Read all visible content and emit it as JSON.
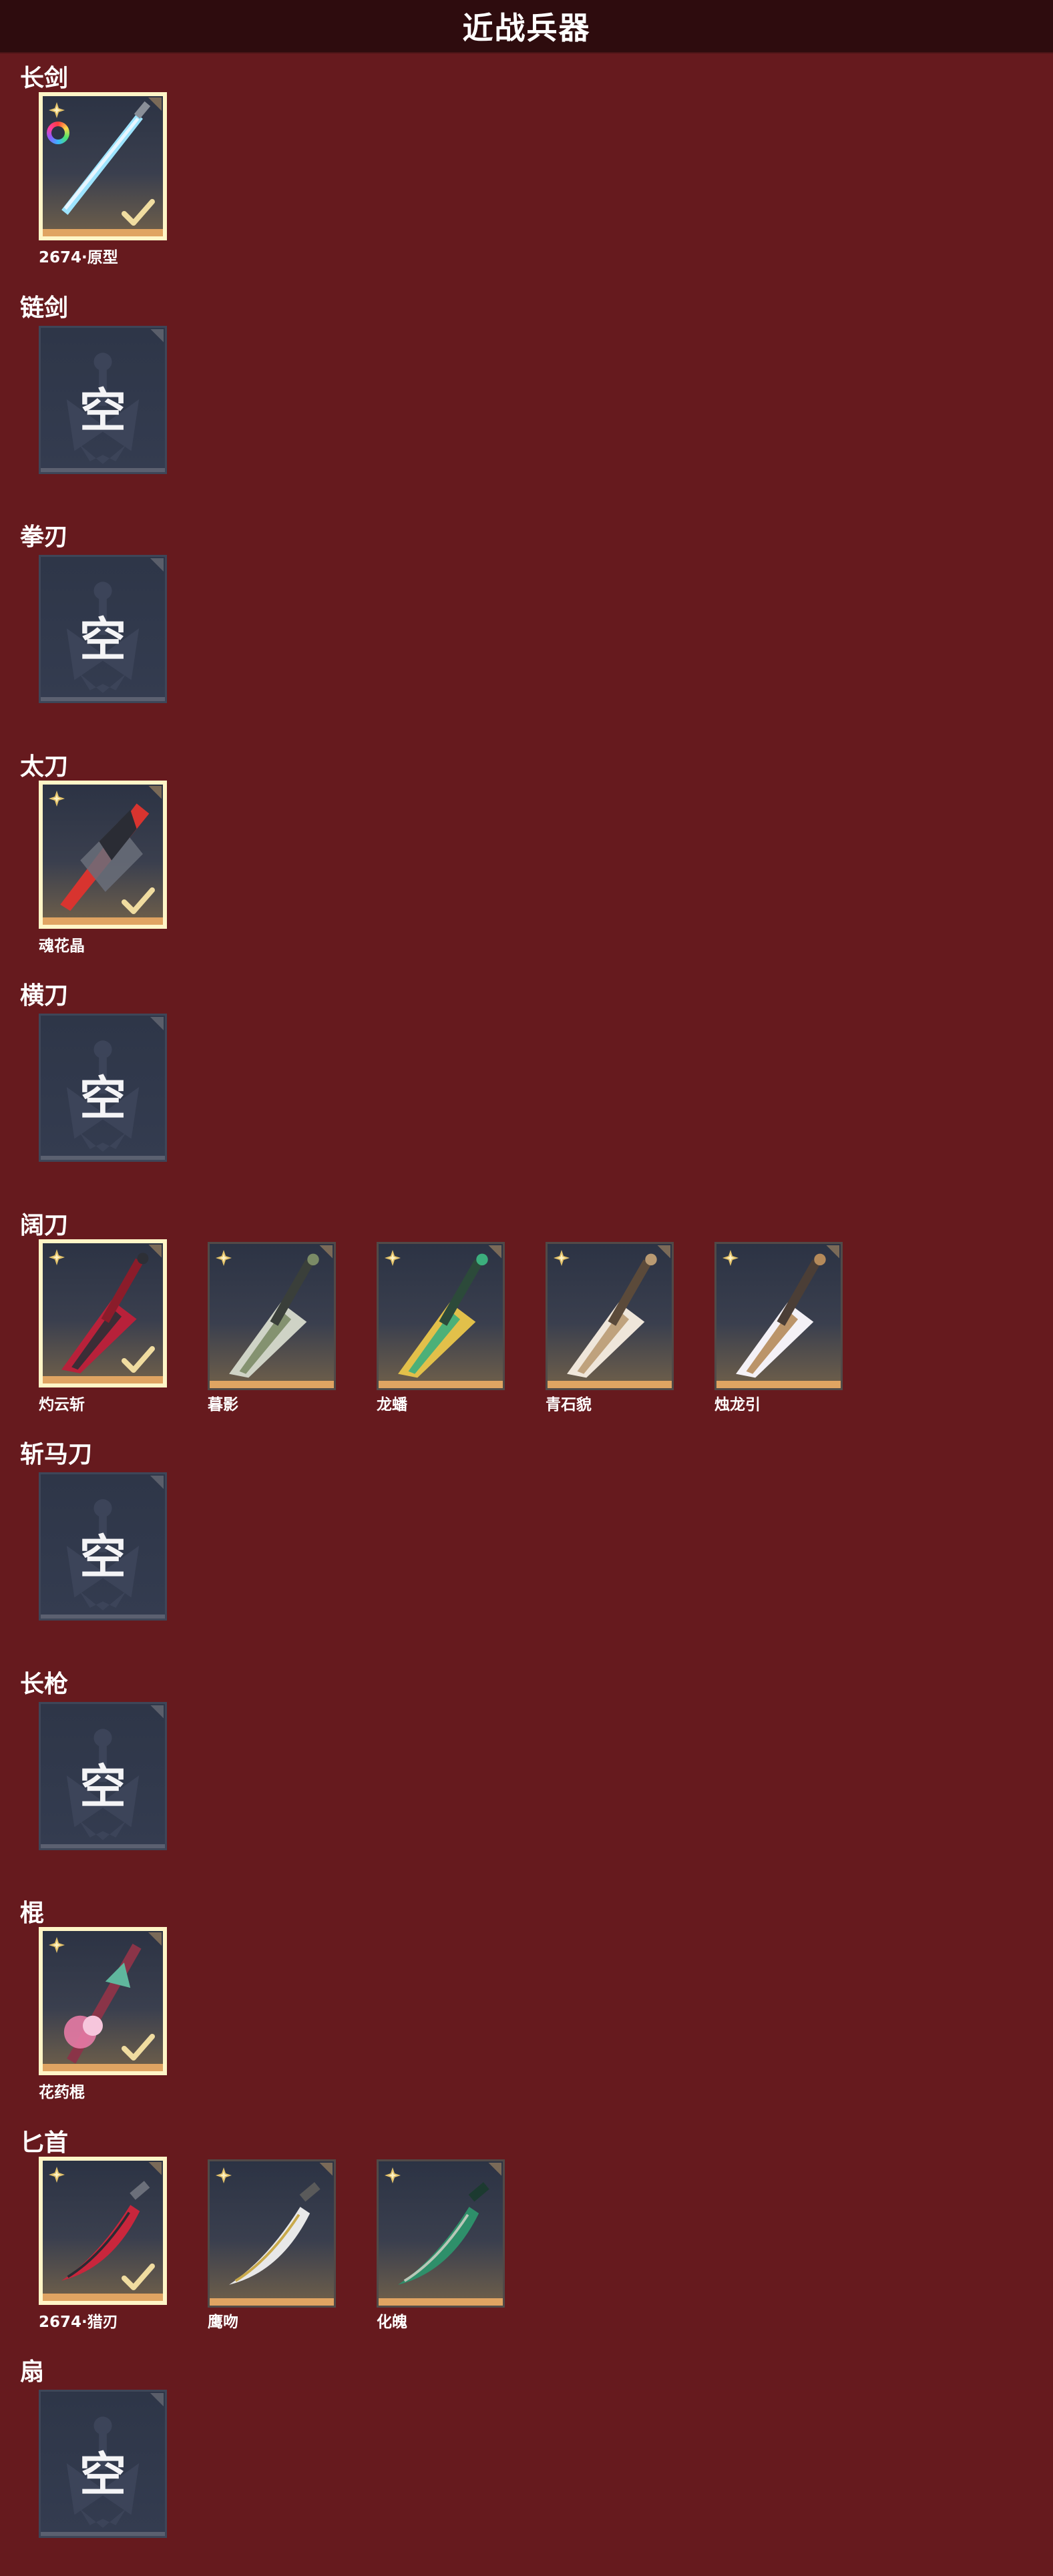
{
  "header": {
    "title": "近战兵器"
  },
  "empty_label": "空",
  "colors": {
    "background": "#661a1e",
    "header_bar": "#2e0c0e",
    "selected_border": "#fff5c7",
    "owned_bar": "#e0a462",
    "star": "#e4c36a",
    "check": "#f0dca0"
  },
  "categories": [
    {
      "name": "长剑",
      "items": [
        {
          "name": "2674·原型",
          "selected": true,
          "icon": "longsword-icon"
        }
      ]
    },
    {
      "name": "链剑",
      "items": []
    },
    {
      "name": "拳刃",
      "items": []
    },
    {
      "name": "太刀",
      "items": [
        {
          "name": "魂花晶",
          "selected": true,
          "icon": "katana-icon"
        }
      ]
    },
    {
      "name": "横刀",
      "items": []
    },
    {
      "name": "阔刀",
      "items": [
        {
          "name": "灼云斩",
          "selected": true,
          "icon": "broadblade-icon"
        },
        {
          "name": "暮影",
          "selected": false,
          "icon": "broadblade-icon"
        },
        {
          "name": "龙蟠",
          "selected": false,
          "icon": "broadblade-icon"
        },
        {
          "name": "青石貌",
          "selected": false,
          "icon": "broadblade-icon"
        },
        {
          "name": "烛龙引",
          "selected": false,
          "icon": "broadblade-icon"
        }
      ]
    },
    {
      "name": "斩马刀",
      "items": []
    },
    {
      "name": "长枪",
      "items": []
    },
    {
      "name": "棍",
      "items": [
        {
          "name": "花药棍",
          "selected": true,
          "icon": "staff-icon"
        }
      ]
    },
    {
      "name": "匕首",
      "items": [
        {
          "name": "2674·猎刃",
          "selected": true,
          "icon": "dagger-icon"
        },
        {
          "name": "鹰吻",
          "selected": false,
          "icon": "dagger-icon"
        },
        {
          "name": "化魄",
          "selected": false,
          "icon": "dagger-icon"
        }
      ]
    },
    {
      "name": "扇",
      "items": []
    }
  ]
}
